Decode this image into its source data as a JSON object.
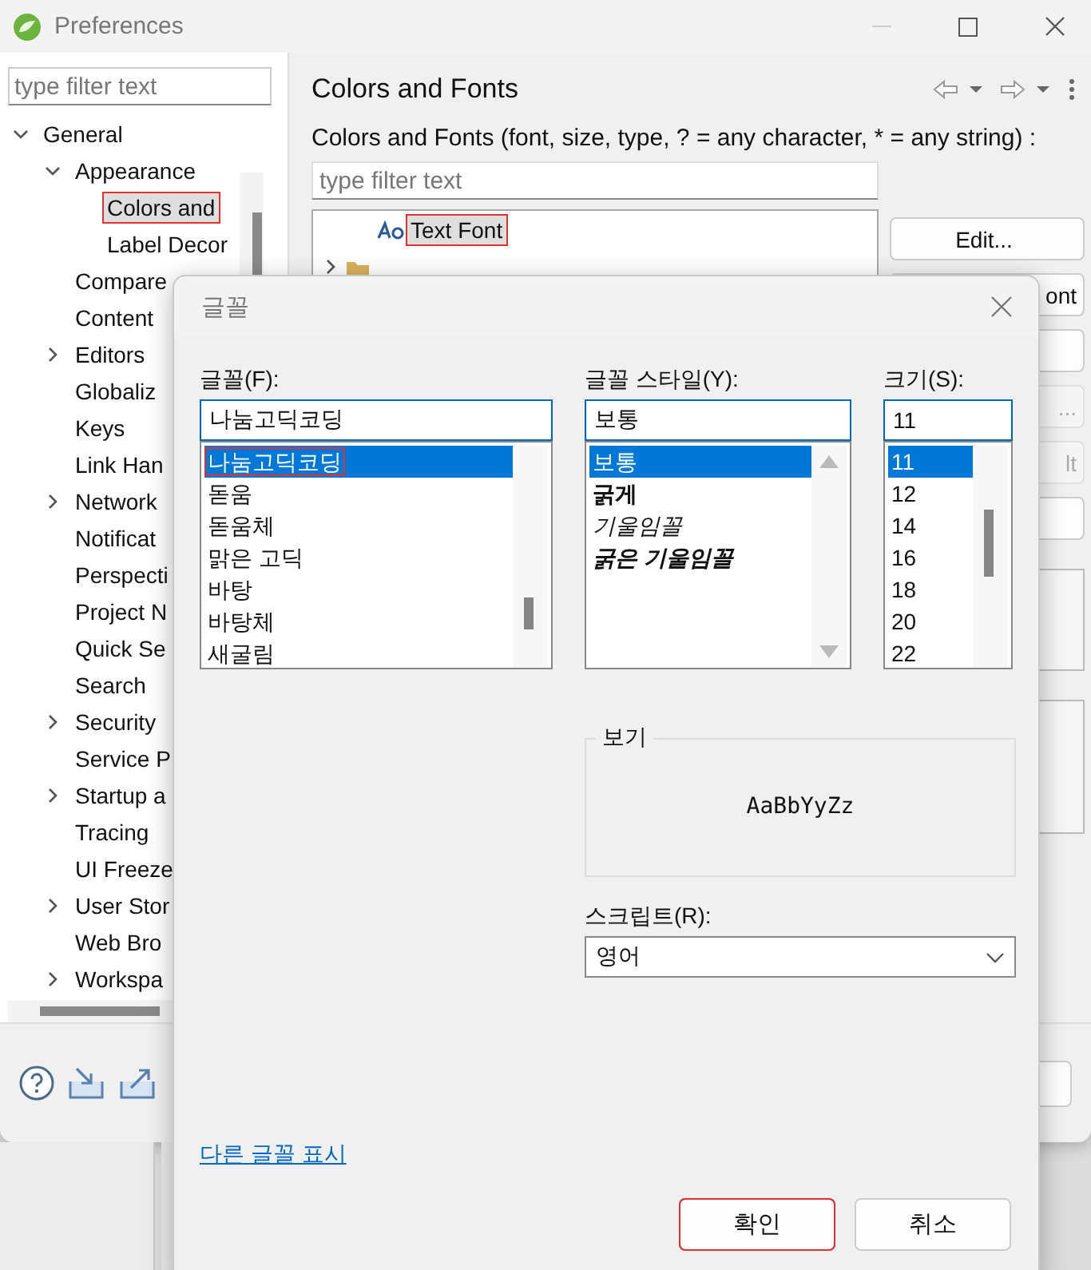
{
  "window": {
    "title": "Preferences"
  },
  "sidebar": {
    "filter_placeholder": "type filter text",
    "tree": [
      {
        "label": "General",
        "expanded": true,
        "selected": false,
        "annotated": false,
        "children": [
          {
            "label": "Appearance",
            "expanded": true,
            "selected": false,
            "annotated": false,
            "children": [
              {
                "label": "Colors and",
                "selected": true,
                "annotated": true
              },
              {
                "label": "Label Decor",
                "selected": false,
                "annotated": false
              }
            ]
          },
          {
            "label": "Compare",
            "selected": false,
            "annotated": false
          },
          {
            "label": "Content",
            "selected": false,
            "annotated": false
          },
          {
            "label": "Editors",
            "expanded": false,
            "selected": false,
            "annotated": false
          },
          {
            "label": "Globaliz",
            "selected": false,
            "annotated": false
          },
          {
            "label": "Keys",
            "selected": false,
            "annotated": false
          },
          {
            "label": "Link Han",
            "selected": false,
            "annotated": false
          },
          {
            "label": "Network",
            "expanded": false,
            "selected": false,
            "annotated": false
          },
          {
            "label": "Notificat",
            "selected": false,
            "annotated": false
          },
          {
            "label": "Perspecti",
            "selected": false,
            "annotated": false
          },
          {
            "label": "Project N",
            "selected": false,
            "annotated": false
          },
          {
            "label": "Quick Se",
            "selected": false,
            "annotated": false
          },
          {
            "label": "Search",
            "selected": false,
            "annotated": false
          },
          {
            "label": "Security",
            "expanded": false,
            "selected": false,
            "annotated": false
          },
          {
            "label": "Service P",
            "selected": false,
            "annotated": false
          },
          {
            "label": "Startup a",
            "expanded": false,
            "selected": false,
            "annotated": false
          },
          {
            "label": "Tracing",
            "selected": false,
            "annotated": false
          },
          {
            "label": "UI Freeze",
            "selected": false,
            "annotated": false
          },
          {
            "label": "User Stor",
            "expanded": false,
            "selected": false,
            "annotated": false
          },
          {
            "label": "Web Bro",
            "selected": false,
            "annotated": false
          },
          {
            "label": "Workspa",
            "expanded": false,
            "selected": false,
            "annotated": false
          }
        ]
      }
    ]
  },
  "page": {
    "title": "Colors and Fonts",
    "description": "Colors and Fonts (font, size, type, ? = any character, * = any string) :",
    "filter_placeholder": "type filter text",
    "tree": [
      {
        "label": "Text Font",
        "kind": "font",
        "selected": true,
        "annotated": true
      },
      {
        "kind": "category",
        "expanded": false
      }
    ],
    "buttons": [
      {
        "label": "Edit...",
        "disabled": false
      },
      {
        "label": "ont",
        "disabled": false
      },
      {
        "disabled": false
      },
      {
        "label": "...",
        "disabled": true
      },
      {
        "label": "lt",
        "disabled": true
      },
      {
        "disabled": false
      }
    ]
  },
  "dialog": {
    "title": "글꼴",
    "font": {
      "label": "글꼴(F):",
      "value": "나눔고딕코딩",
      "options": [
        {
          "label": "나눔고딕코딩",
          "selected": true,
          "annotated": true
        },
        {
          "label": "돋움",
          "selected": false,
          "annotated": false
        },
        {
          "label": "돋움체",
          "selected": false,
          "annotated": false
        },
        {
          "label": "맑은 고딕",
          "selected": false,
          "annotated": false
        },
        {
          "label": "바탕",
          "selected": false,
          "annotated": false
        },
        {
          "label": "바탕체",
          "selected": false,
          "annotated": false
        },
        {
          "label": "새굴림",
          "selected": false,
          "annotated": false
        }
      ]
    },
    "style": {
      "label": "글꼴 스타일(Y):",
      "value": "보통",
      "options": [
        {
          "label": "보통",
          "selected": true,
          "bold": false,
          "italic": false
        },
        {
          "label": "굵게",
          "selected": false,
          "bold": true,
          "italic": false
        },
        {
          "label": "기울임꼴",
          "selected": false,
          "bold": false,
          "italic": true
        },
        {
          "label": "굵은 기울임꼴",
          "selected": false,
          "bold": true,
          "italic": true
        }
      ]
    },
    "size": {
      "label": "크기(S):",
      "value": "11",
      "options": [
        {
          "label": "11",
          "selected": true
        },
        {
          "label": "12",
          "selected": false
        },
        {
          "label": "14",
          "selected": false
        },
        {
          "label": "16",
          "selected": false
        },
        {
          "label": "18",
          "selected": false
        },
        {
          "label": "20",
          "selected": false
        },
        {
          "label": "22",
          "selected": false
        }
      ]
    },
    "sample": {
      "legend": "보기",
      "text": "AaBbYyZz"
    },
    "script": {
      "label": "스크립트(R):",
      "value": "영어"
    },
    "link": "다른 글꼴 표시",
    "buttons": [
      {
        "label": "확인",
        "default": true,
        "annotated": true
      },
      {
        "label": "취소",
        "default": false,
        "annotated": false
      }
    ]
  }
}
